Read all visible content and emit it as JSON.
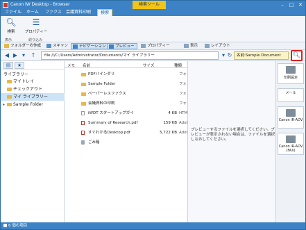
{
  "window": {
    "title": "Canon iW Desktop - Browser",
    "context_tab": "検索ツール"
  },
  "ribbon_tabs": [
    "ファイル",
    "ホーム",
    "ファクス",
    "会議資料印刷",
    "検索"
  ],
  "ribbon": {
    "search_label": "検索",
    "property_label": "プロパティー",
    "group_display": "表示",
    "group_refine": "絞り込み"
  },
  "quickbar": {
    "folder_label": "フォルダーの作成",
    "scan_label": "スキャン",
    "navigation_label": "ナビゲーション",
    "preview_label": "プレビュー",
    "properties_label": "プロパティー",
    "view_label": "表示",
    "layout_label": "レイアウト"
  },
  "address": {
    "path": "file:///C:/Users/Administrator/Documents/マイ ライブラリー",
    "search_value": "名前:Sample Document"
  },
  "left": {
    "library_header": "ライブラリー",
    "tree": [
      {
        "label": "マイトレイ",
        "selected": false
      },
      {
        "label": "チェックアウト",
        "selected": false
      },
      {
        "label": "マイ ライブラリー",
        "selected": true
      },
      {
        "label": "Sample Folder",
        "selected": false
      }
    ]
  },
  "columns": {
    "memo": "メモ",
    "name": "名前",
    "size": "サイズ",
    "type": "種類"
  },
  "files": [
    {
      "icon": "folder",
      "name": "PDFバインダリ",
      "size": "",
      "type": "フォルダ"
    },
    {
      "icon": "folder",
      "name": "Sample Folder",
      "size": "",
      "type": "フォルダ"
    },
    {
      "icon": "folder",
      "name": "ペーパーレスファクス",
      "size": "",
      "type": "フォルダ"
    },
    {
      "icon": "folder",
      "name": "会議資料の印刷",
      "size": "",
      "type": "フォルダ"
    },
    {
      "icon": "doc",
      "name": "iWDT スタートアップガイ",
      "size": "4 KB",
      "type": "HTML"
    },
    {
      "icon": "pdf",
      "name": "Summary of Research.pdf",
      "size": "159 KB",
      "type": "Adobe"
    },
    {
      "icon": "pdf",
      "name": "すぐわかるDesktop.pdf",
      "size": "5,722 KB",
      "type": "Adobe"
    },
    {
      "icon": "trash",
      "name": "ごみ箱",
      "size": "",
      "type": ""
    }
  ],
  "preview": {
    "message": "プレビューするファイルを選択してください。プレビューが表示されない場合は、ファイルを選択しなおしてください。"
  },
  "right": [
    {
      "label": "印刷設定"
    },
    {
      "label": "メール"
    },
    {
      "label": "Canon iR-ADV"
    },
    {
      "label": "Canon iR-ADV (FAX)"
    }
  ],
  "status": {
    "text": "6 個の項目"
  }
}
